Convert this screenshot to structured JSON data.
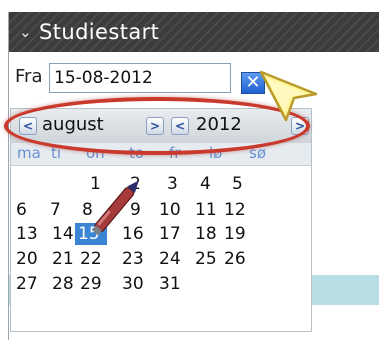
{
  "section": {
    "title": "Studiestart",
    "collapsed": false
  },
  "from_field": {
    "label": "Fra",
    "value": "15-08-2012",
    "clear_label": "✕"
  },
  "calendar": {
    "month": "august",
    "year": "2012",
    "prev_month": "<",
    "next_month": ">",
    "prev_year": "<",
    "next_year": ">",
    "weekdays": [
      "ma",
      "ti",
      "on",
      "to",
      "fr",
      "lø",
      "sø"
    ],
    "weeks": [
      [
        "",
        "",
        "1",
        "2",
        "3",
        "4",
        "5"
      ],
      [
        "6",
        "7",
        "8",
        "9",
        "10",
        "11",
        "12"
      ],
      [
        "13",
        "14",
        "15",
        "16",
        "17",
        "18",
        "19"
      ],
      [
        "20",
        "21",
        "22",
        "23",
        "24",
        "25",
        "26"
      ],
      [
        "27",
        "28",
        "29",
        "30",
        "31",
        "",
        ""
      ]
    ],
    "selected_day": "15"
  },
  "colors": {
    "header_bg": "#3c3c3c",
    "selected_day_bg": "#3a86d4",
    "highlight_ellipse": "#c9392c",
    "cursor_fill": "#fff59a",
    "teal_band": "#b8dde2"
  },
  "icons": {
    "collapse": "chevron-down-icon",
    "clear": "close-icon",
    "pointer": "cursor-arrow-icon",
    "annotation": "pen-icon"
  }
}
